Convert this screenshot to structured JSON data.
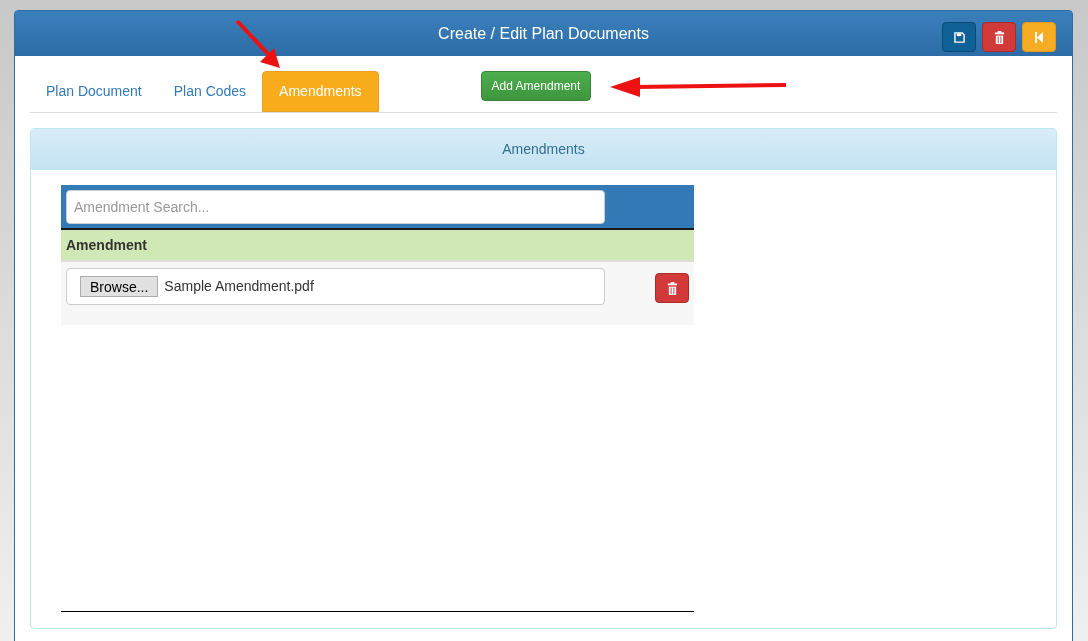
{
  "window": {
    "title": "Create / Edit Plan Documents"
  },
  "toolbar": [
    {
      "kind": "save"
    },
    {
      "kind": "delete"
    },
    {
      "kind": "back"
    }
  ],
  "tabs": [
    {
      "label": "Plan Document",
      "selected": false
    },
    {
      "label": "Plan Codes",
      "selected": false
    },
    {
      "label": "Amendments",
      "selected": true
    }
  ],
  "add_button": "Add Amendment",
  "panel": {
    "title": "Amendments",
    "search": {
      "placeholder": "Amendment Search..."
    },
    "columns": [
      "Amendment"
    ],
    "rows": [
      {
        "browse": "Browse...",
        "file": "Sample Amendment.pdf"
      }
    ]
  }
}
